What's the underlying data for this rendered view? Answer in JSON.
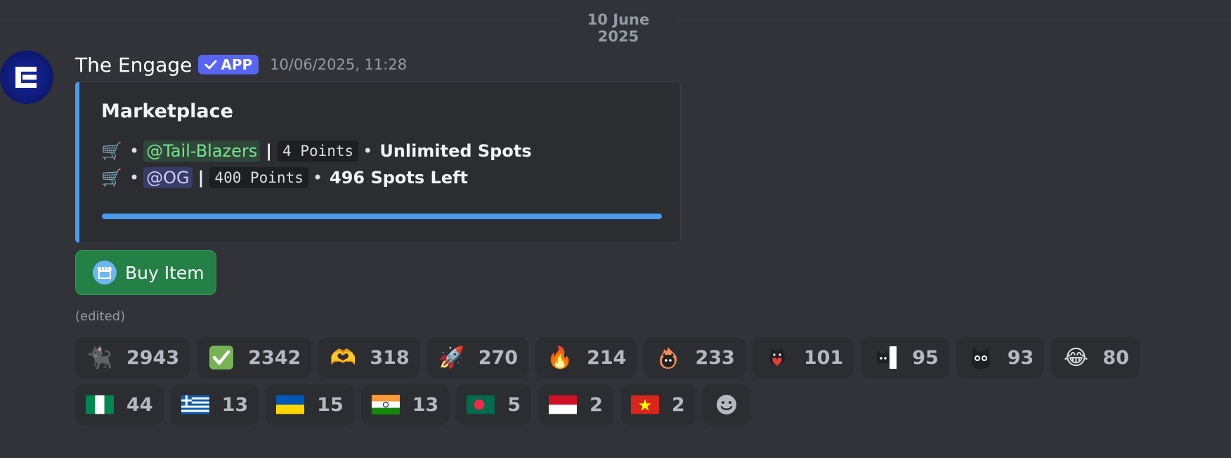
{
  "date_divider": "10 June 2025",
  "message": {
    "author": "The Engage",
    "badge": "APP",
    "timestamp": "10/06/2025, 11:28",
    "edited": "(edited)"
  },
  "embed": {
    "title": "Marketplace",
    "items": [
      {
        "mention": "@Tail-Blazers",
        "points": "4 Points",
        "spots": "Unlimited Spots"
      },
      {
        "mention": "@OG",
        "points": "400 Points",
        "spots": "496 Spots Left"
      }
    ],
    "bullet": "•",
    "separator": "|",
    "accent_color": "#4a9af0"
  },
  "button": {
    "label": "Buy Item",
    "icon": "store-icon",
    "color": "#248046"
  },
  "reactions": [
    {
      "emoji": "black-cat",
      "count": "2943"
    },
    {
      "emoji": "check-mark",
      "count": "2342"
    },
    {
      "emoji": "heart-hands",
      "count": "318"
    },
    {
      "emoji": "rocket",
      "count": "270"
    },
    {
      "emoji": "fire",
      "count": "214"
    },
    {
      "emoji": "cat-fire",
      "count": "233"
    },
    {
      "emoji": "cat-heart",
      "count": "101"
    },
    {
      "emoji": "cat-peek",
      "count": "95"
    },
    {
      "emoji": "cat-stare",
      "count": "93"
    },
    {
      "emoji": "laughing-tears",
      "count": "80"
    },
    {
      "emoji": "flag-nigeria",
      "count": "44"
    },
    {
      "emoji": "flag-greece",
      "count": "13"
    },
    {
      "emoji": "flag-ukraine",
      "count": "15"
    },
    {
      "emoji": "flag-india",
      "count": "13"
    },
    {
      "emoji": "flag-bangladesh",
      "count": "5"
    },
    {
      "emoji": "flag-indonesia",
      "count": "2"
    },
    {
      "emoji": "flag-vietnam",
      "count": "2"
    }
  ]
}
